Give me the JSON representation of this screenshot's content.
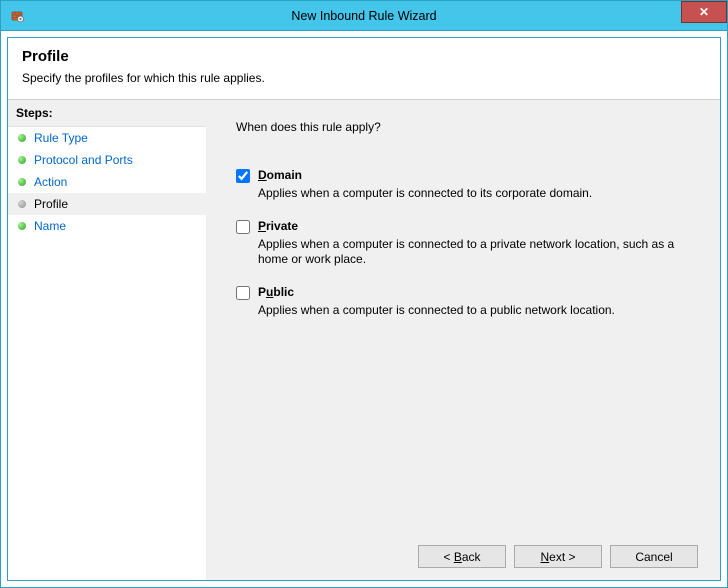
{
  "window": {
    "title": "New Inbound Rule Wizard",
    "close_glyph": "✕"
  },
  "header": {
    "title": "Profile",
    "subtitle": "Specify the profiles for which this rule applies."
  },
  "sidebar": {
    "heading": "Steps:",
    "items": [
      {
        "label": "Rule Type",
        "state": "done"
      },
      {
        "label": "Protocol and Ports",
        "state": "done"
      },
      {
        "label": "Action",
        "state": "done"
      },
      {
        "label": "Profile",
        "state": "current"
      },
      {
        "label": "Name",
        "state": "pending"
      }
    ]
  },
  "main": {
    "question": "When does this rule apply?",
    "options": [
      {
        "key": "domain",
        "checked": true,
        "title_pre": "",
        "title_accel": "D",
        "title_post": "omain",
        "desc": "Applies when a computer is connected to its corporate domain."
      },
      {
        "key": "private",
        "checked": false,
        "title_pre": "",
        "title_accel": "P",
        "title_post": "rivate",
        "desc": "Applies when a computer is connected to a private network location, such as a home or work place."
      },
      {
        "key": "public",
        "checked": false,
        "title_pre": "P",
        "title_accel": "u",
        "title_post": "blic",
        "desc": "Applies when a computer is connected to a public network location."
      }
    ]
  },
  "footer": {
    "back_pre": "< ",
    "back_accel": "B",
    "back_post": "ack",
    "next_accel": "N",
    "next_post": "ext >",
    "cancel": "Cancel"
  }
}
